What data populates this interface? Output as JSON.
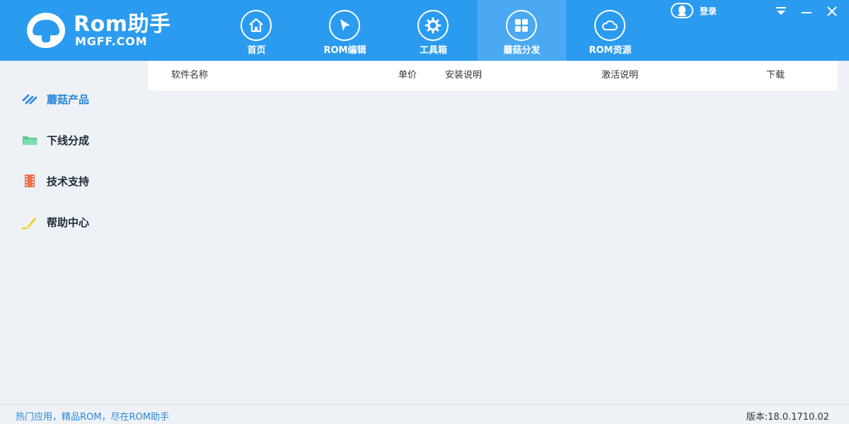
{
  "app": {
    "logo_title": "Rom助手",
    "logo_subtitle": "MGFF.COM"
  },
  "nav": {
    "tabs": [
      {
        "label": "首页",
        "icon": "home-icon"
      },
      {
        "label": "ROM编辑",
        "icon": "cursor-arrow-icon"
      },
      {
        "label": "工具箱",
        "icon": "gear-icon"
      },
      {
        "label": "蘑菇分发",
        "icon": "grid-icon",
        "active": true
      },
      {
        "label": "ROM资源",
        "icon": "cloud-icon"
      }
    ]
  },
  "header": {
    "login_label": "登录",
    "login_icon": "qq-penguin-icon",
    "window_controls": [
      "dropdown-icon",
      "minimize-icon",
      "close-icon"
    ]
  },
  "sidebar": {
    "items": [
      {
        "label": "蘑菇产品",
        "icon": "stripes-icon",
        "active": true
      },
      {
        "label": "下线分成",
        "icon": "folder-icon"
      },
      {
        "label": "技术支持",
        "icon": "film-icon"
      },
      {
        "label": "帮助中心",
        "icon": "pencil-icon"
      }
    ]
  },
  "table": {
    "columns": [
      "软件名称",
      "单价",
      "安装说明",
      "激活说明",
      "下载"
    ],
    "rows": []
  },
  "footer": {
    "slogan": "热门应用，精品ROM，尽在ROM助手",
    "version": "版本:18.0.1710.02"
  },
  "colors": {
    "header_bg": "#2b9bf0",
    "active_tab_bg": "#4aa9f2",
    "accent_text": "#2b86d8",
    "page_bg": "#eef1f6"
  }
}
